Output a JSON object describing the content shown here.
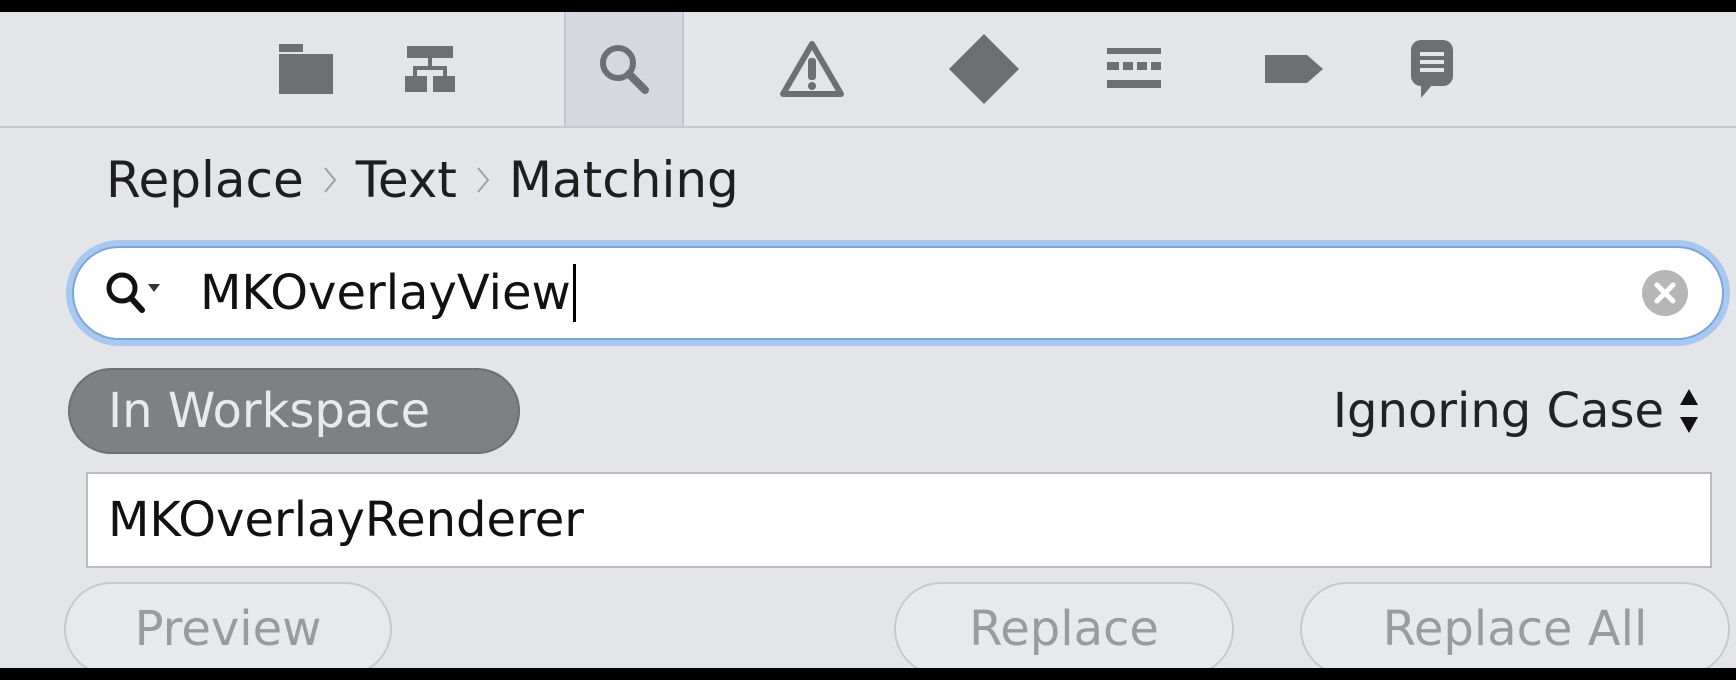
{
  "navigator": {
    "icons": [
      "folder-icon",
      "hierarchy-icon",
      "search-icon",
      "warning-icon",
      "diamond-icon",
      "debug-icon",
      "breakpoint-icon",
      "log-icon"
    ],
    "active_index": 2
  },
  "breadcrumb": {
    "items": [
      "Replace",
      "Text",
      "Matching"
    ]
  },
  "search": {
    "value": "MKOverlayView"
  },
  "scope": {
    "label": "In Workspace"
  },
  "case_option": {
    "label": "Ignoring Case"
  },
  "replace": {
    "value": "MKOverlayRenderer"
  },
  "buttons": {
    "preview": "Preview",
    "replace": "Replace",
    "replace_all": "Replace All"
  },
  "colors": {
    "panel_bg": "#e3e5e9",
    "icon_gray": "#6e6f73",
    "focus_ring": "#a9c8ef",
    "scope_pill": "#7e8084",
    "disabled_text": "#9a9b9e"
  }
}
